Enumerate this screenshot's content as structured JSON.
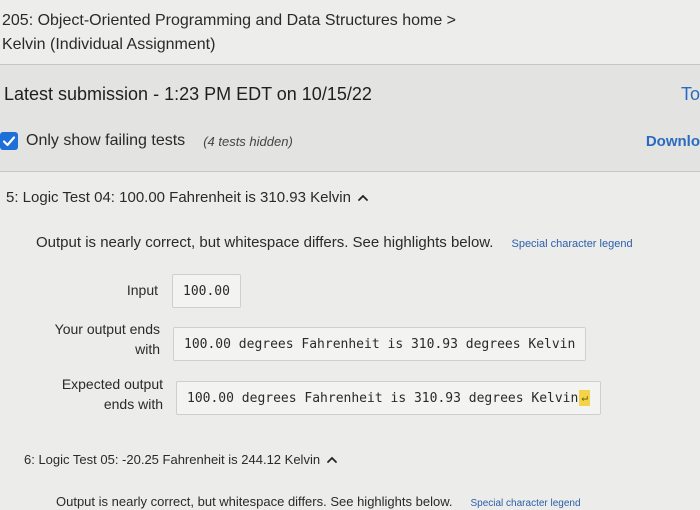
{
  "breadcrumb": {
    "course_link": "205: Object-Oriented Programming and Data Structures home >",
    "assignment": "Kelvin (Individual Assignment)"
  },
  "submission": {
    "title": "Latest submission - 1:23 PM EDT on 10/15/22",
    "right_link": "To"
  },
  "filter": {
    "label": "Only show failing tests",
    "hidden_count": "(4 tests hidden)",
    "checked": true,
    "download_link": "Downlo"
  },
  "tests": [
    {
      "title": "5: Logic Test 04: 100.00 Fahrenheit is 310.93 Kelvin",
      "status": "Output is nearly correct, but whitespace differs. See highlights below.",
      "legend": "Special character legend",
      "input_label": "Input",
      "input_value": "100.00",
      "your_output_label_1": "Your output ends",
      "your_output_label_2": "with",
      "your_output": "100.00 degrees Fahrenheit is 310.93 degrees Kelvin",
      "expected_label_1": "Expected output",
      "expected_label_2": "ends with",
      "expected_output": "100.00 degrees Fahrenheit is 310.93 degrees Kelvin",
      "newline_symbol": "↵"
    },
    {
      "title": "6: Logic Test 05: -20.25 Fahrenheit is 244.12 Kelvin",
      "status": "Output is nearly correct, but whitespace differs. See highlights below.",
      "legend": "Special character legend"
    }
  ],
  "colors": {
    "accent": "#1f6fd8",
    "link": "#2a6bbf",
    "highlight": "#f2d34a"
  }
}
